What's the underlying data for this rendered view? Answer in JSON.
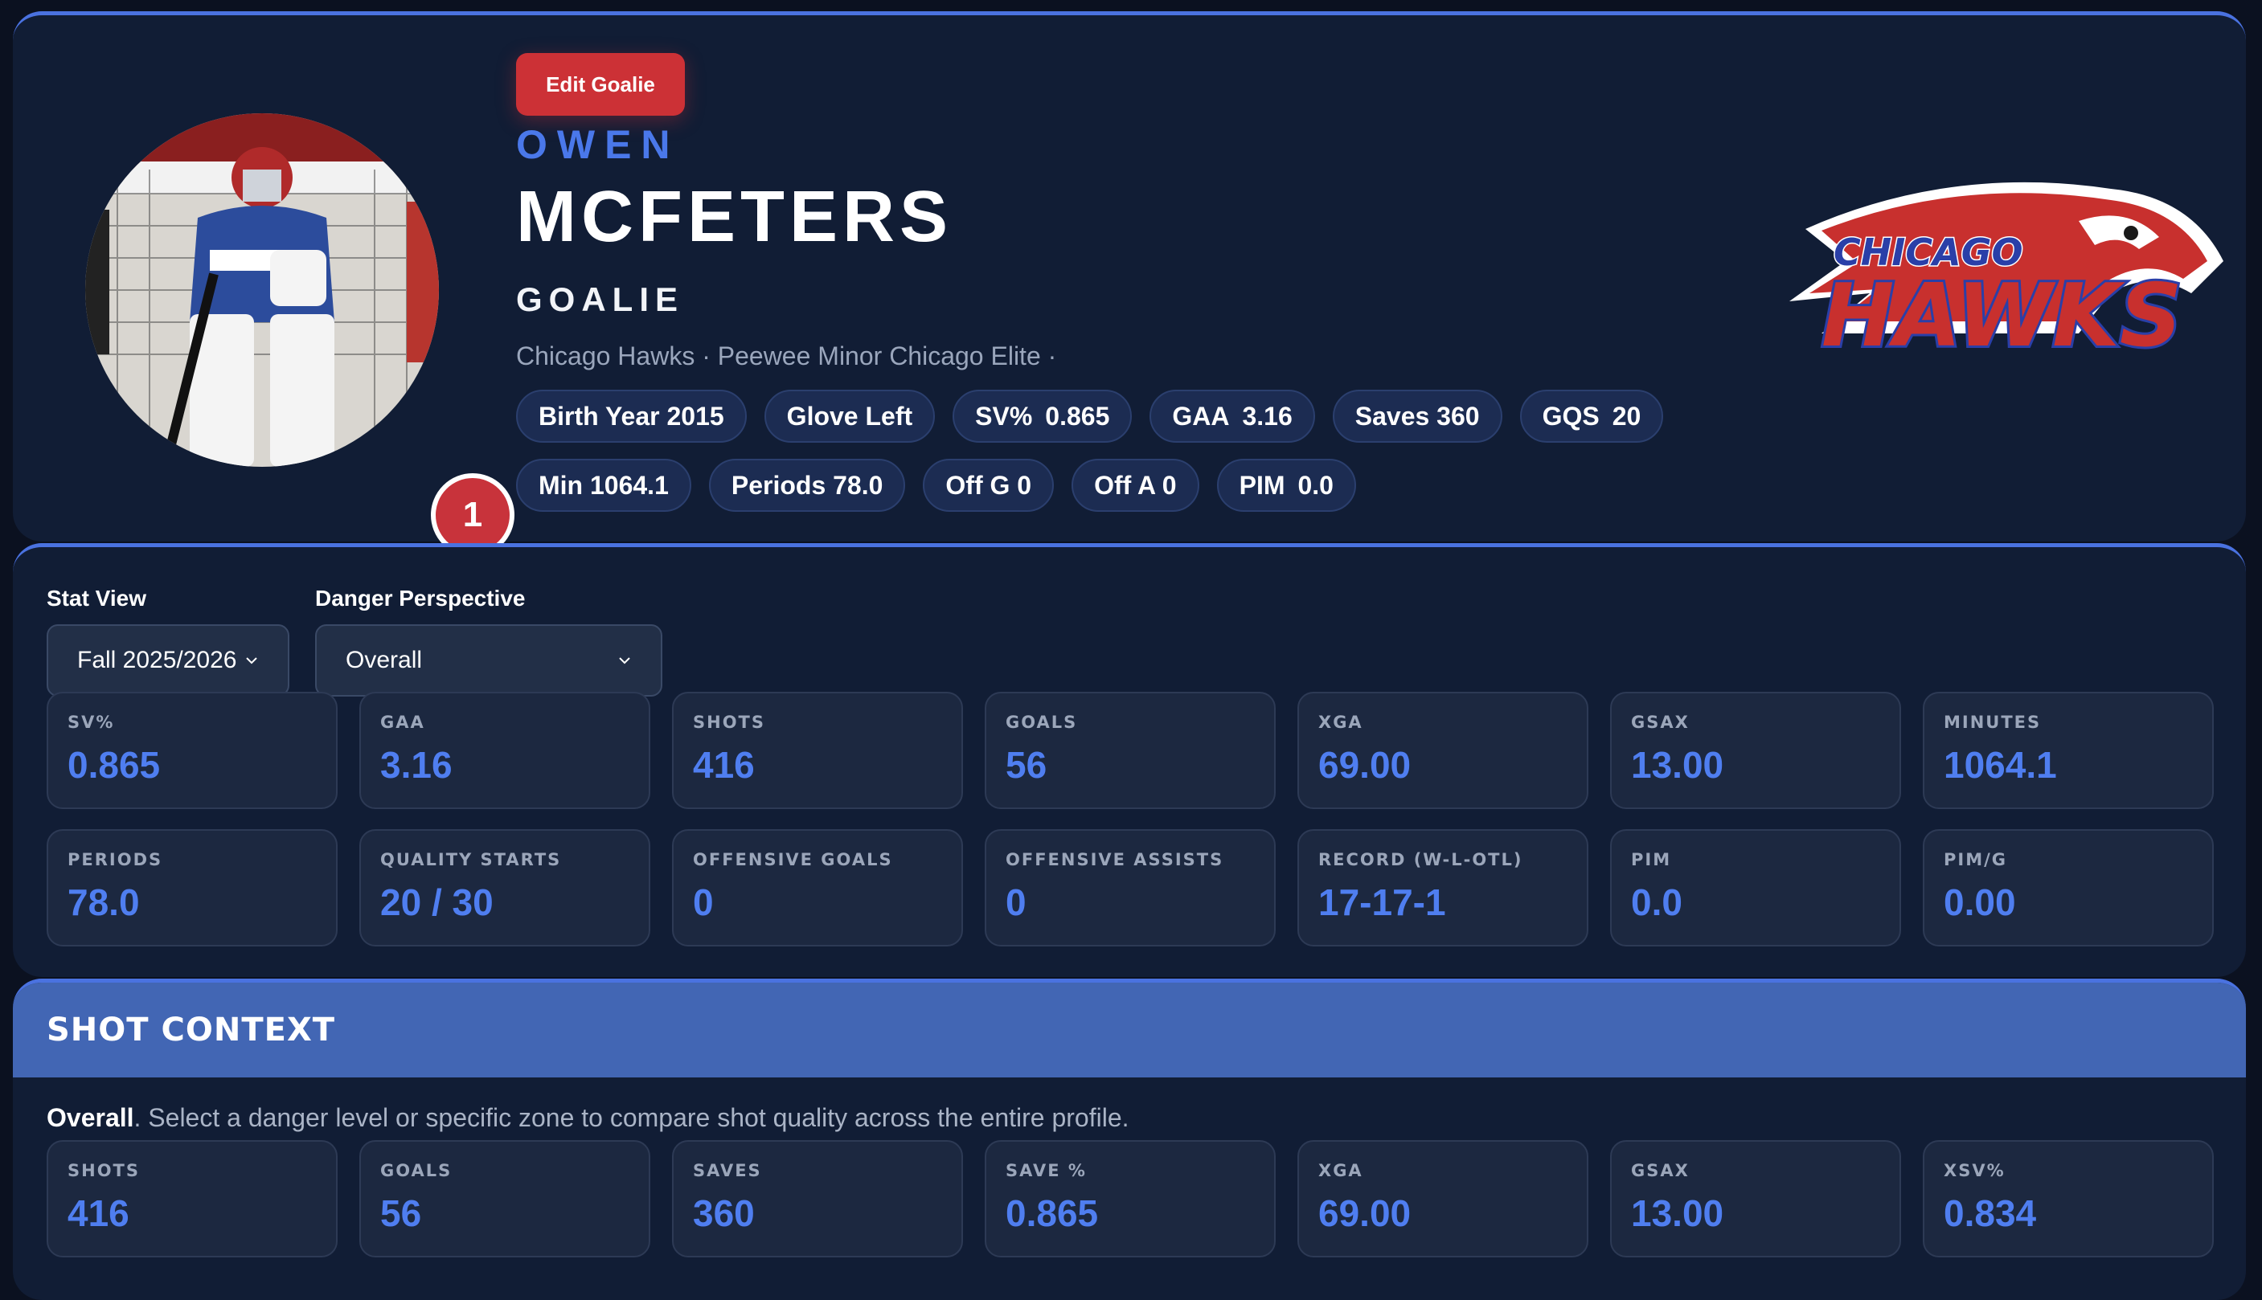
{
  "profile": {
    "edit_label": "Edit Goalie",
    "first_name": "OWEN",
    "last_name": "MCFETERS",
    "position": "GOALIE",
    "team_line": "Chicago Hawks · Peewee Minor Chicago Elite ·",
    "number": "1",
    "logo_text_top": "CHICAGO",
    "logo_text_bottom": "HAWKS",
    "pills_row1": [
      {
        "label": "Birth Year 2015",
        "value": ""
      },
      {
        "label": "Glove Left",
        "value": ""
      },
      {
        "label": "SV%",
        "value": "0.865"
      },
      {
        "label": "GAA",
        "value": "3.16"
      },
      {
        "label": "Saves 360",
        "value": ""
      },
      {
        "label": "GQS",
        "value": "20"
      }
    ],
    "pills_row2": [
      {
        "label": "Min 1064.1",
        "value": ""
      },
      {
        "label": "Periods 78.0",
        "value": ""
      },
      {
        "label": "Off G 0",
        "value": ""
      },
      {
        "label": "Off A 0",
        "value": ""
      },
      {
        "label": "PIM",
        "value": "0.0"
      }
    ]
  },
  "controls": {
    "stat_view_label": "Stat View",
    "stat_view_value": "Fall 2025/2026",
    "danger_label": "Danger Perspective",
    "danger_value": "Overall"
  },
  "stats_row1": [
    {
      "label": "SV%",
      "value": "0.865"
    },
    {
      "label": "GAA",
      "value": "3.16"
    },
    {
      "label": "SHOTS",
      "value": "416"
    },
    {
      "label": "GOALS",
      "value": "56"
    },
    {
      "label": "XGA",
      "value": "69.00"
    },
    {
      "label": "GSAX",
      "value": "13.00"
    },
    {
      "label": "MINUTES",
      "value": "1064.1"
    }
  ],
  "stats_row2": [
    {
      "label": "PERIODS",
      "value": "78.0"
    },
    {
      "label": "QUALITY STARTS",
      "value": "20 / 30"
    },
    {
      "label": "OFFENSIVE GOALS",
      "value": "0"
    },
    {
      "label": "OFFENSIVE ASSISTS",
      "value": "0"
    },
    {
      "label": "RECORD (W-L-OTL)",
      "value": "17-17-1"
    },
    {
      "label": "PIM",
      "value": "0.0"
    },
    {
      "label": "PIM/G",
      "value": "0.00"
    }
  ],
  "shot_context": {
    "title": "SHOT CONTEXT",
    "desc_bold": "Overall",
    "desc_rest": ". Select a danger level or specific zone to compare shot quality across the entire profile.",
    "stats": [
      {
        "label": "SHOTS",
        "value": "416"
      },
      {
        "label": "GOALS",
        "value": "56"
      },
      {
        "label": "SAVES",
        "value": "360"
      },
      {
        "label": "SAVE %",
        "value": "0.865"
      },
      {
        "label": "XGA",
        "value": "69.00"
      },
      {
        "label": "GSAX",
        "value": "13.00"
      },
      {
        "label": "XSV%",
        "value": "0.834"
      }
    ]
  },
  "colors": {
    "accent": "#4f7ef0",
    "danger": "#cc3136",
    "card": "#111d35",
    "header": "#4266b4"
  }
}
